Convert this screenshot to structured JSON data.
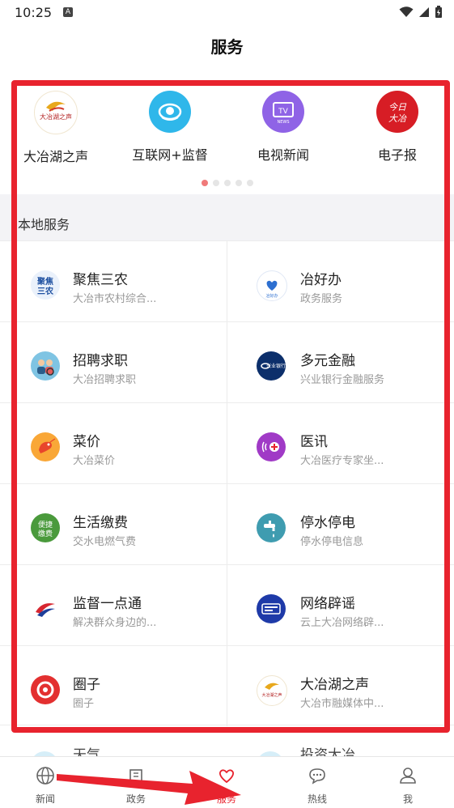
{
  "status": {
    "time": "10:25",
    "badge": "A"
  },
  "header": {
    "title": "服务"
  },
  "top_items": [
    {
      "label": "大冶湖之声",
      "icon": "dayehu-voice-logo"
    },
    {
      "label": "互联网+监督",
      "icon": "eye-icon"
    },
    {
      "label": "电视新闻",
      "icon": "tv-news-icon",
      "icon_text": "TV",
      "icon_sub": "NEWS"
    },
    {
      "label": "电子报",
      "icon": "epaper-icon",
      "icon_text": "今日大冶"
    }
  ],
  "pager": {
    "count": 5,
    "active": 0
  },
  "section": {
    "title": "本地服务"
  },
  "services": [
    {
      "title": "聚焦三农",
      "subtitle": "大冶市农村综合...",
      "icon": "sannong-icon"
    },
    {
      "title": "冶好办",
      "subtitle": "政务服务",
      "icon": "yehaoban-icon"
    },
    {
      "title": "招聘求职",
      "subtitle": "大冶招聘求职",
      "icon": "job-icon"
    },
    {
      "title": "多元金融",
      "subtitle": "兴业银行金融服务",
      "icon": "bank-icon"
    },
    {
      "title": "菜价",
      "subtitle": "大冶菜价",
      "icon": "shrimp-icon"
    },
    {
      "title": "医讯",
      "subtitle": "大冶医疗专家坐...",
      "icon": "medical-icon"
    },
    {
      "title": "生活缴费",
      "subtitle": "交水电燃气费",
      "icon": "payment-icon"
    },
    {
      "title": "停水停电",
      "subtitle": "停水停电信息",
      "icon": "faucet-icon"
    },
    {
      "title": "监督一点通",
      "subtitle": "解决群众身边的...",
      "icon": "supervision-icon"
    },
    {
      "title": "网络辟谣",
      "subtitle": "云上大冶网络辟...",
      "icon": "rumor-icon"
    },
    {
      "title": "圈子",
      "subtitle": "圈子",
      "icon": "circle-icon"
    },
    {
      "title": "大冶湖之声",
      "subtitle": "大冶市融媒体中...",
      "icon": "dayehu-voice-logo"
    }
  ],
  "peek": {
    "left": "天气",
    "right": "投资大冶"
  },
  "tabs": [
    {
      "label": "新闻",
      "icon": "globe-icon",
      "active": false
    },
    {
      "label": "政务",
      "icon": "building-icon",
      "active": false
    },
    {
      "label": "服务",
      "icon": "heart-icon",
      "active": true
    },
    {
      "label": "热线",
      "icon": "chat-icon",
      "active": false
    },
    {
      "label": "我",
      "icon": "user-icon",
      "active": false
    }
  ],
  "colors": {
    "accent": "#e8232e",
    "annotation": "#e8232e"
  }
}
